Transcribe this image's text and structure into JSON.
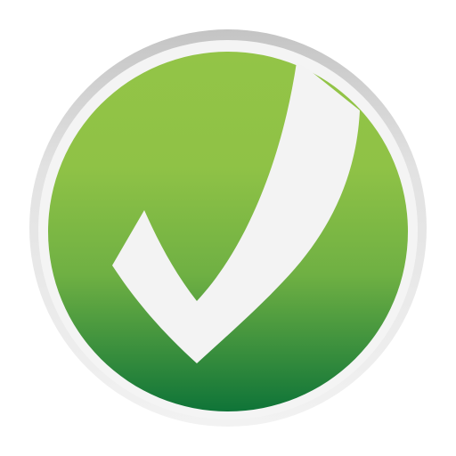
{
  "icon": {
    "name": "checkmark-badge",
    "colors": {
      "ring_outer": "#c4c4c4",
      "ring_inner": "#f2f2f2",
      "gradient_top": "#93c447",
      "gradient_mid": "#6fb043",
      "gradient_bottom": "#0f7438",
      "check": "#f3f3f3"
    }
  }
}
